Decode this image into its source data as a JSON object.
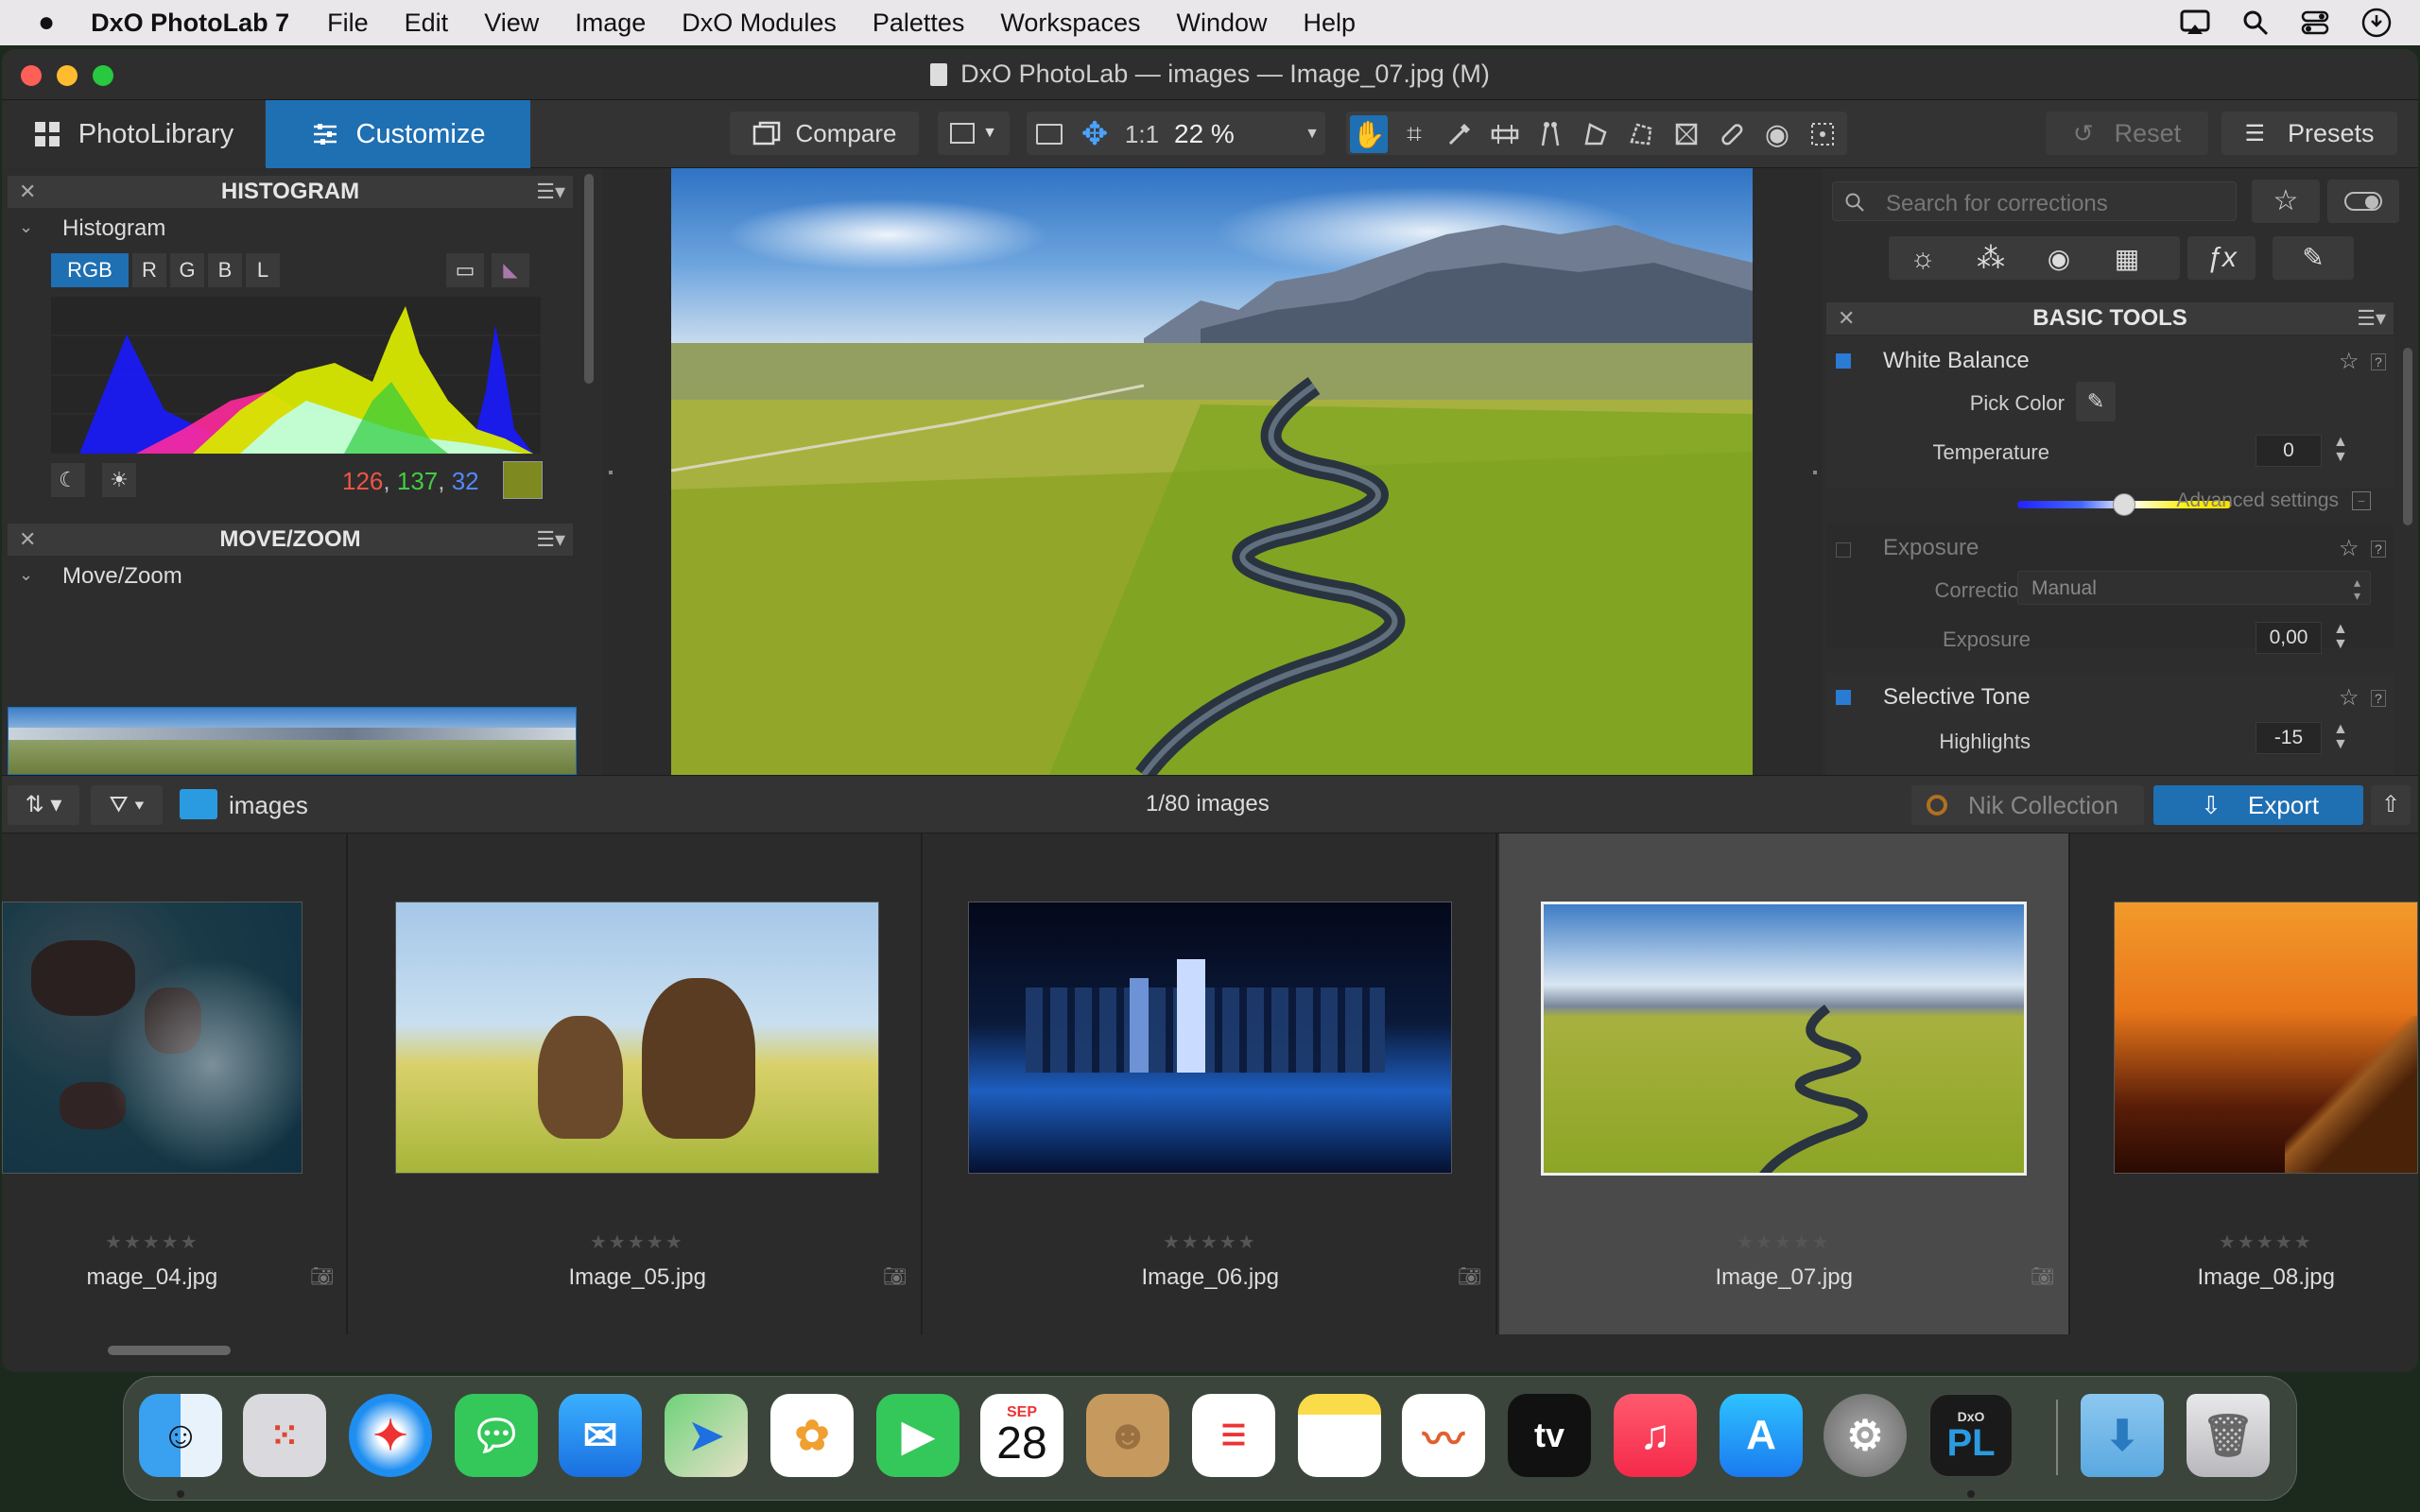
{
  "menubar": {
    "apple_icon": "apple-icon",
    "app_name": "DxO PhotoLab 7",
    "items": [
      "File",
      "Edit",
      "View",
      "Image",
      "DxO Modules",
      "Palettes",
      "Workspaces",
      "Window",
      "Help"
    ]
  },
  "window": {
    "title": "DxO PhotoLab — images — Image_07.jpg (M)"
  },
  "toolbar": {
    "tab_library": "PhotoLibrary",
    "tab_customize": "Customize",
    "compare": "Compare",
    "one_to_one": "1:1",
    "zoom": "22 %",
    "reset": "Reset",
    "presets": "Presets"
  },
  "histogram": {
    "panel_title": "HISTOGRAM",
    "section": "Histogram",
    "channels": [
      "RGB",
      "R",
      "G",
      "B",
      "L"
    ],
    "value_r": "126",
    "value_g": "137",
    "value_b": "32",
    "sep1": ",",
    "sep2": ",",
    "swatch_color": "#7e8920"
  },
  "movezoom": {
    "panel_title": "MOVE/ZOOM",
    "section": "Move/Zoom"
  },
  "corrections": {
    "search_placeholder": "Search for corrections",
    "panel_title": "BASIC TOOLS",
    "white_balance": "White Balance",
    "pick_color": "Pick Color",
    "temperature_label": "Temperature",
    "temperature_value": "0",
    "advanced_settings": "Advanced settings",
    "exposure_section": "Exposure",
    "correction_label": "Correction",
    "correction_value": "Manual",
    "exposure_label": "Exposure",
    "exposure_value": "0,00",
    "selective_tone": "Selective Tone",
    "highlights_label": "Highlights",
    "highlights_value": "-15"
  },
  "browser": {
    "folder": "images",
    "count": "1/80 images",
    "nik": "Nik Collection",
    "export": "Export"
  },
  "filmstrip": [
    {
      "name": "mage_04.jpg",
      "stars": "★★★★★"
    },
    {
      "name": "Image_05.jpg",
      "stars": "★★★★★"
    },
    {
      "name": "Image_06.jpg",
      "stars": "★★★★★"
    },
    {
      "name": "Image_07.jpg",
      "stars": "★★★★★"
    },
    {
      "name": "Image_08.jpg",
      "stars": "★★★★★"
    }
  ],
  "dock": {
    "calendar_month": "SEP",
    "calendar_day": "28",
    "tv_label": "tv",
    "dxo_small": "DxO",
    "dxo_big": "PL"
  }
}
